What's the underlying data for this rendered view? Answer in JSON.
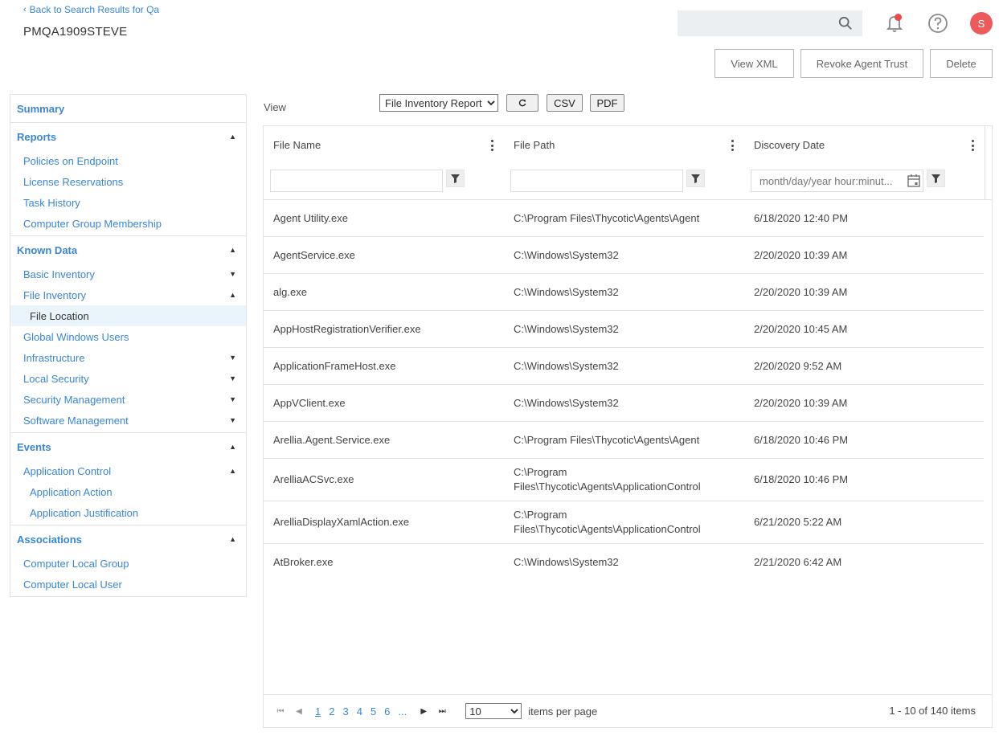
{
  "header": {
    "back_link": "Back to Search Results for Qa",
    "title": "PMQA1909STEVE",
    "search_placeholder": "",
    "avatar_initial": "S",
    "icons": {
      "search": "search-icon",
      "notifications": "bell-icon",
      "help": "help-circle-icon"
    },
    "notification_dot_color": "#e84c4c",
    "avatar_color": "#ec5b5b"
  },
  "actions": {
    "view_xml": "View XML",
    "revoke_trust": "Revoke Agent Trust",
    "delete": "Delete"
  },
  "sidebar": {
    "summary": "Summary",
    "reports": {
      "label": "Reports",
      "items": [
        "Policies on Endpoint",
        "License Reservations",
        "Task History",
        "Computer Group Membership"
      ]
    },
    "known_data": {
      "label": "Known Data",
      "basic_inventory": "Basic Inventory",
      "file_inventory": "File Inventory",
      "file_location": "File Location",
      "global_windows_users": "Global Windows Users",
      "infrastructure": "Infrastructure",
      "local_security": "Local Security",
      "security_management": "Security Management",
      "software_management": "Software Management"
    },
    "events": {
      "label": "Events",
      "application_control": "Application Control",
      "application_action": "Application Action",
      "application_justification": "Application Justification"
    },
    "associations": {
      "label": "Associations",
      "items": [
        "Computer Local Group",
        "Computer Local User"
      ]
    },
    "accent_color": "#3a86d4",
    "active_bg": "#eaf4fb"
  },
  "toolbar": {
    "view_label": "View",
    "report_selected": "File Inventory Report",
    "refresh_icon": "refresh-icon",
    "csv": "CSV",
    "pdf": "PDF"
  },
  "grid": {
    "columns": [
      {
        "title": "File Name",
        "filter_value": "",
        "filter_placeholder": ""
      },
      {
        "title": "File Path",
        "filter_value": "",
        "filter_placeholder": ""
      },
      {
        "title": "Discovery Date",
        "filter_value": "",
        "filter_placeholder": "month/day/year hour:minut..."
      }
    ],
    "rows": [
      {
        "name": "Agent Utility.exe",
        "path": "C:\\Program Files\\Thycotic\\Agents\\Agent",
        "date": "6/18/2020 12:40 PM"
      },
      {
        "name": "AgentService.exe",
        "path": "C:\\Windows\\System32",
        "date": "2/20/2020 10:39 AM"
      },
      {
        "name": "alg.exe",
        "path": "C:\\Windows\\System32",
        "date": "2/20/2020 10:39 AM"
      },
      {
        "name": "AppHostRegistrationVerifier.exe",
        "path": "C:\\Windows\\System32",
        "date": "2/20/2020 10:45 AM"
      },
      {
        "name": "ApplicationFrameHost.exe",
        "path": "C:\\Windows\\System32",
        "date": "2/20/2020 9:52 AM"
      },
      {
        "name": "AppVClient.exe",
        "path": "C:\\Windows\\System32",
        "date": "2/20/2020 10:39 AM"
      },
      {
        "name": "Arellia.Agent.Service.exe",
        "path": "C:\\Program Files\\Thycotic\\Agents\\Agent",
        "date": "6/18/2020 10:46 PM"
      },
      {
        "name": "ArelliaACSvc.exe",
        "path": "C:\\Program Files\\Thycotic\\Agents\\ApplicationControl",
        "date": "6/18/2020 10:46 PM"
      },
      {
        "name": "ArelliaDisplayXamlAction.exe",
        "path": "C:\\Program Files\\Thycotic\\Agents\\ApplicationControl",
        "date": "6/21/2020 5:22 AM"
      },
      {
        "name": "AtBroker.exe",
        "path": "C:\\Windows\\System32",
        "date": "2/21/2020 6:42 AM"
      }
    ]
  },
  "pager": {
    "pages": [
      "1",
      "2",
      "3",
      "4",
      "5",
      "6",
      "..."
    ],
    "current_page": "1",
    "page_size": "10",
    "page_size_label": "items per page",
    "info": "1 - 10 of 140 items"
  }
}
